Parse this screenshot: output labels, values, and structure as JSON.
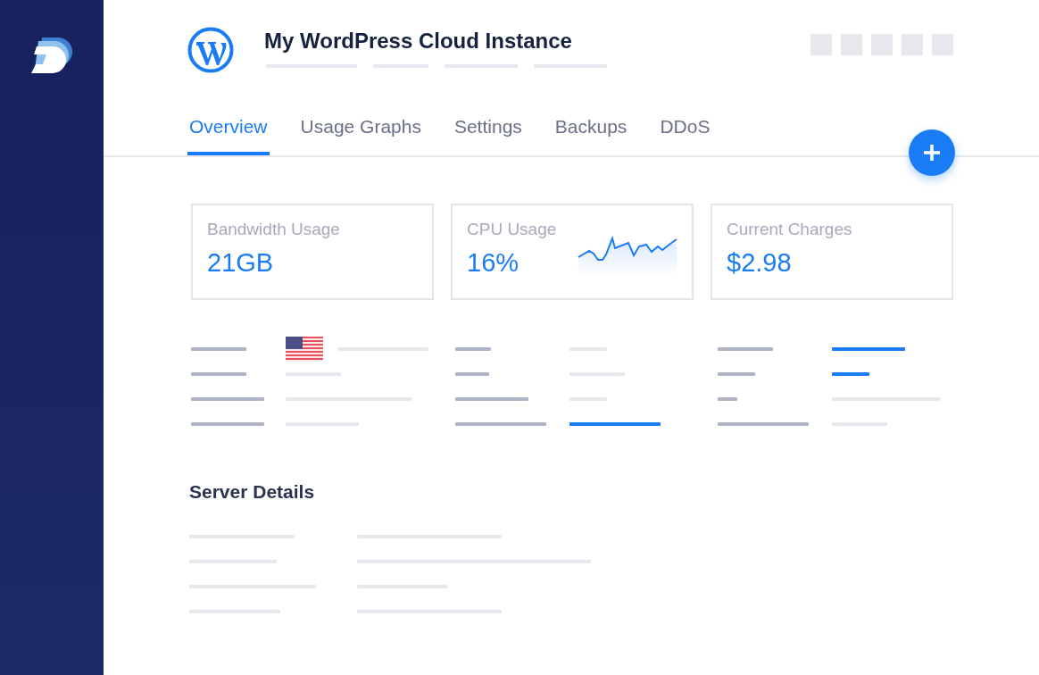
{
  "header": {
    "title": "My WordPress Cloud Instance"
  },
  "tabs": [
    {
      "label": "Overview",
      "selected": true
    },
    {
      "label": "Usage Graphs",
      "selected": false
    },
    {
      "label": "Settings",
      "selected": false
    },
    {
      "label": "Backups",
      "selected": false
    },
    {
      "label": "DDoS",
      "selected": false
    }
  ],
  "stats": [
    {
      "kind": "plain",
      "label": "Bandwidth Usage",
      "value": "21GB"
    },
    {
      "kind": "sparkline",
      "label": "CPU Usage",
      "value": "16%"
    },
    {
      "kind": "plain",
      "label": "Current Charges",
      "value": "$2.98"
    }
  ],
  "server_details": {
    "heading": "Server Details"
  }
}
